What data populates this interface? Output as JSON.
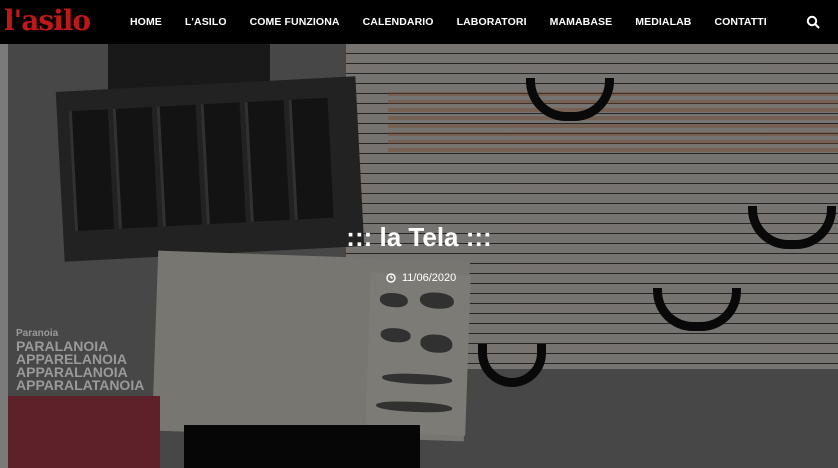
{
  "site": {
    "logo_text": "l'asilo"
  },
  "nav": {
    "items": [
      {
        "label": "HOME"
      },
      {
        "label": "L'ASILO"
      },
      {
        "label": "COME FUNZIONA"
      },
      {
        "label": "CALENDARIO"
      },
      {
        "label": "LABORATORI"
      },
      {
        "label": "MAMABASE"
      },
      {
        "label": "MEDIALAB"
      },
      {
        "label": "CONTATTI"
      }
    ],
    "search_icon": "search-icon"
  },
  "hero": {
    "title": "::: la Tela :::",
    "date": "11/06/2020",
    "collage_lines": [
      "Paranoia",
      "PARALANOIA",
      "APPARELANOIA",
      "APPARALANOIA",
      "APPARALATANOIA"
    ]
  },
  "colors": {
    "logo": "#c01818",
    "nav_bg": "#000000",
    "nav_text": "#ffffff"
  }
}
